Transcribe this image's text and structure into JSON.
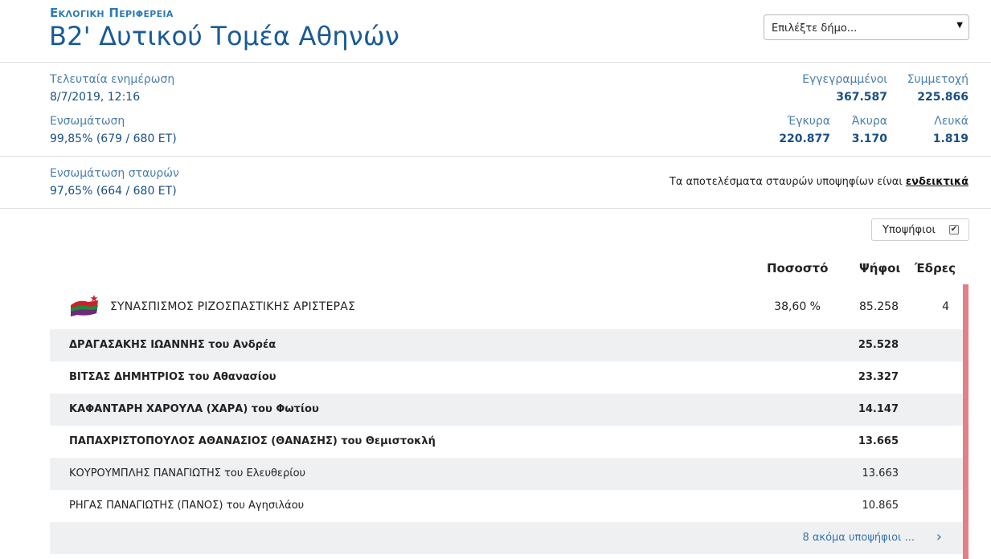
{
  "header": {
    "supertitle": "Εκλογικη Περιφερεια",
    "title": "Β2' Δυτικού Τομέα Αθηνών",
    "select_placeholder": "Επιλέξτε δήμο...",
    "select_arrow": "▼"
  },
  "stats": {
    "last_update_label": "Τελευταία ενημέρωση",
    "last_update_value": "8/7/2019, 12:16",
    "integration_label": "Ενσωμάτωση",
    "integration_value": "99,85% (679 / 680 ΕΤ)",
    "registered_label": "Εγγεγραμμένοι",
    "registered_value": "367.587",
    "turnout_label": "Συμμετοχή",
    "turnout_value": "225.866",
    "valid_label": "Έγκυρα",
    "valid_value": "220.877",
    "invalid_label": "Άκυρα",
    "invalid_value": "3.170",
    "blank_label": "Λευκά",
    "blank_value": "1.819",
    "cross_integration_label": "Ενσωμάτωση σταυρών",
    "cross_integration_value": "97,65% (664 / 680 ΕΤ)",
    "note_text": "Τα αποτελέσματα σταυρών υποψηφίων είναι ",
    "note_link": "ενδεικτικά"
  },
  "toggle": {
    "label": "Υποψήφιοι",
    "checked_mark": "✔"
  },
  "columns": {
    "pct": "Ποσοστό",
    "votes": "Ψήφοι",
    "seats": "Έδρες"
  },
  "party": {
    "name": "ΣΥΝΑΣΠΙΣΜΟΣ ΡΙΖΟΣΠΑΣΤΙΚΗΣ ΑΡΙΣΤΕΡΑΣ",
    "pct": "38,60 %",
    "votes": "85.258",
    "seats": "4",
    "accent_color": "#e57f86"
  },
  "candidates": [
    {
      "name": "ΔΡΑΓΑΣΑΚΗΣ ΙΩΑΝΝΗΣ του Ανδρέα",
      "votes": "25.528"
    },
    {
      "name": "ΒΙΤΣΑΣ ΔΗΜΗΤΡΙΟΣ του Αθανασίου",
      "votes": "23.327"
    },
    {
      "name": "ΚΑΦΑΝΤΑΡΗ ΧΑΡΟΥΛΑ (ΧΑΡΑ) του Φωτίου",
      "votes": "14.147"
    },
    {
      "name": "ΠΑΠΑΧΡΙΣΤΟΠΟΥΛΟΣ ΑΘΑΝΑΣΙΟΣ (ΘΑΝΑΣΗΣ) του Θεμιστοκλή",
      "votes": "13.665"
    },
    {
      "name": "ΚΟΥΡΟΥΜΠΛΗΣ ΠΑΝΑΓΙΩΤΗΣ του Ελευθερίου",
      "votes": "13.663"
    },
    {
      "name": "ΡΗΓΑΣ ΠΑΝΑΓΙΩΤΗΣ (ΠΑΝΟΣ) του Αγησιλάου",
      "votes": "10.865"
    }
  ],
  "more": {
    "label": "8 ακόμα υποψήφιοι ...",
    "chevron": "›"
  }
}
